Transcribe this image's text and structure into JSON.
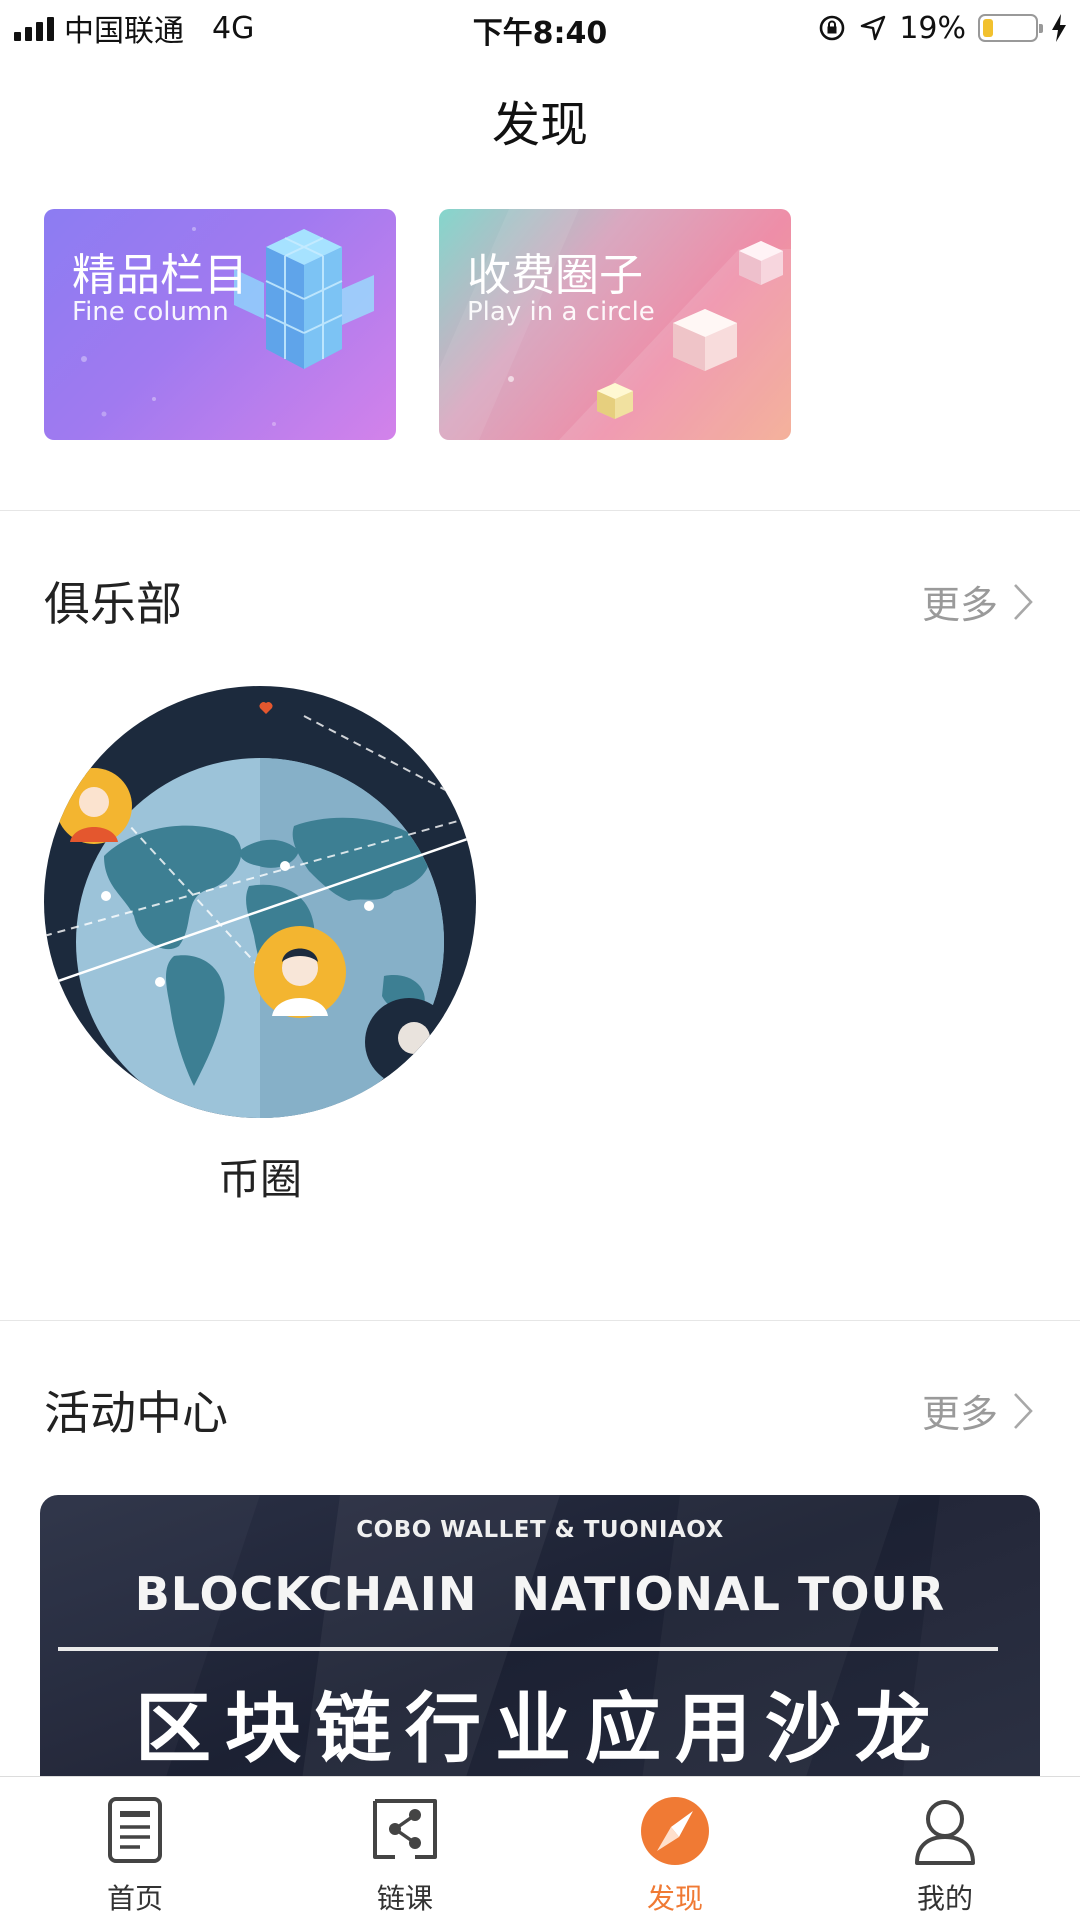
{
  "status_bar": {
    "carrier": "中国联通",
    "network": "4G",
    "time": "下午8:40",
    "battery_percent": "19%",
    "battery_level": 0.19
  },
  "page": {
    "title": "发现"
  },
  "cards": [
    {
      "title": "精品栏目",
      "subtitle": "Fine column"
    },
    {
      "title": "收费圈子",
      "subtitle": "Play in a circle"
    }
  ],
  "club": {
    "title": "俱乐部",
    "more": "更多",
    "items": [
      {
        "label": "币圈"
      }
    ]
  },
  "activity": {
    "title": "活动中心",
    "more": "更多",
    "banner": {
      "top_line": "COBO WALLET & TUONIAOX",
      "main_line": "BLOCKCHAIN  NATIONAL TOUR",
      "cn_line": "区块链行业应用沙龙"
    }
  },
  "tabs": [
    {
      "label": "首页",
      "icon": "document-icon",
      "active": false
    },
    {
      "label": "链课",
      "icon": "share-icon",
      "active": false
    },
    {
      "label": "发现",
      "icon": "compass-icon",
      "active": true
    },
    {
      "label": "我的",
      "icon": "person-icon",
      "active": false
    }
  ],
  "colors": {
    "accent": "#f07a34",
    "battery": "#f2c12e"
  }
}
